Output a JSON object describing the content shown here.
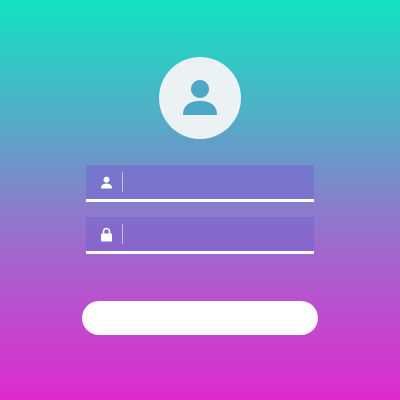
{
  "avatar": {
    "icon": "user-avatar-icon",
    "background_color": "#ecf1f3",
    "icon_color": "#4fa7c7"
  },
  "form": {
    "username": {
      "icon": "user-icon",
      "value": "",
      "placeholder": ""
    },
    "password": {
      "icon": "lock-icon",
      "value": "",
      "placeholder": ""
    },
    "submit": {
      "label": ""
    }
  },
  "colors": {
    "gradient_top": "#12e2c2",
    "gradient_bottom": "#de2bce",
    "field_fill": "#7664cd",
    "underline": "#ffffff"
  }
}
